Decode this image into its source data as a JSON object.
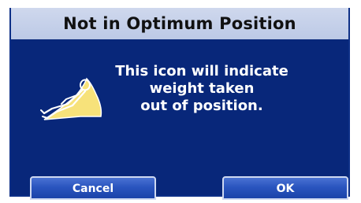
{
  "dialog": {
    "title": "Not in Optimum Position",
    "message_lines": [
      "This icon will indicate",
      "weight taken",
      "out of position."
    ],
    "icon": "reclined-seat-occupant-icon",
    "buttons": {
      "cancel_label": "Cancel",
      "ok_label": "OK"
    }
  },
  "colors": {
    "panel_background": "#08277a",
    "title_bar": "#c8d3ec",
    "icon_seat_fill": "#f7e27a",
    "button_fill": "#2a55bf",
    "button_border": "#cfd9f1"
  }
}
